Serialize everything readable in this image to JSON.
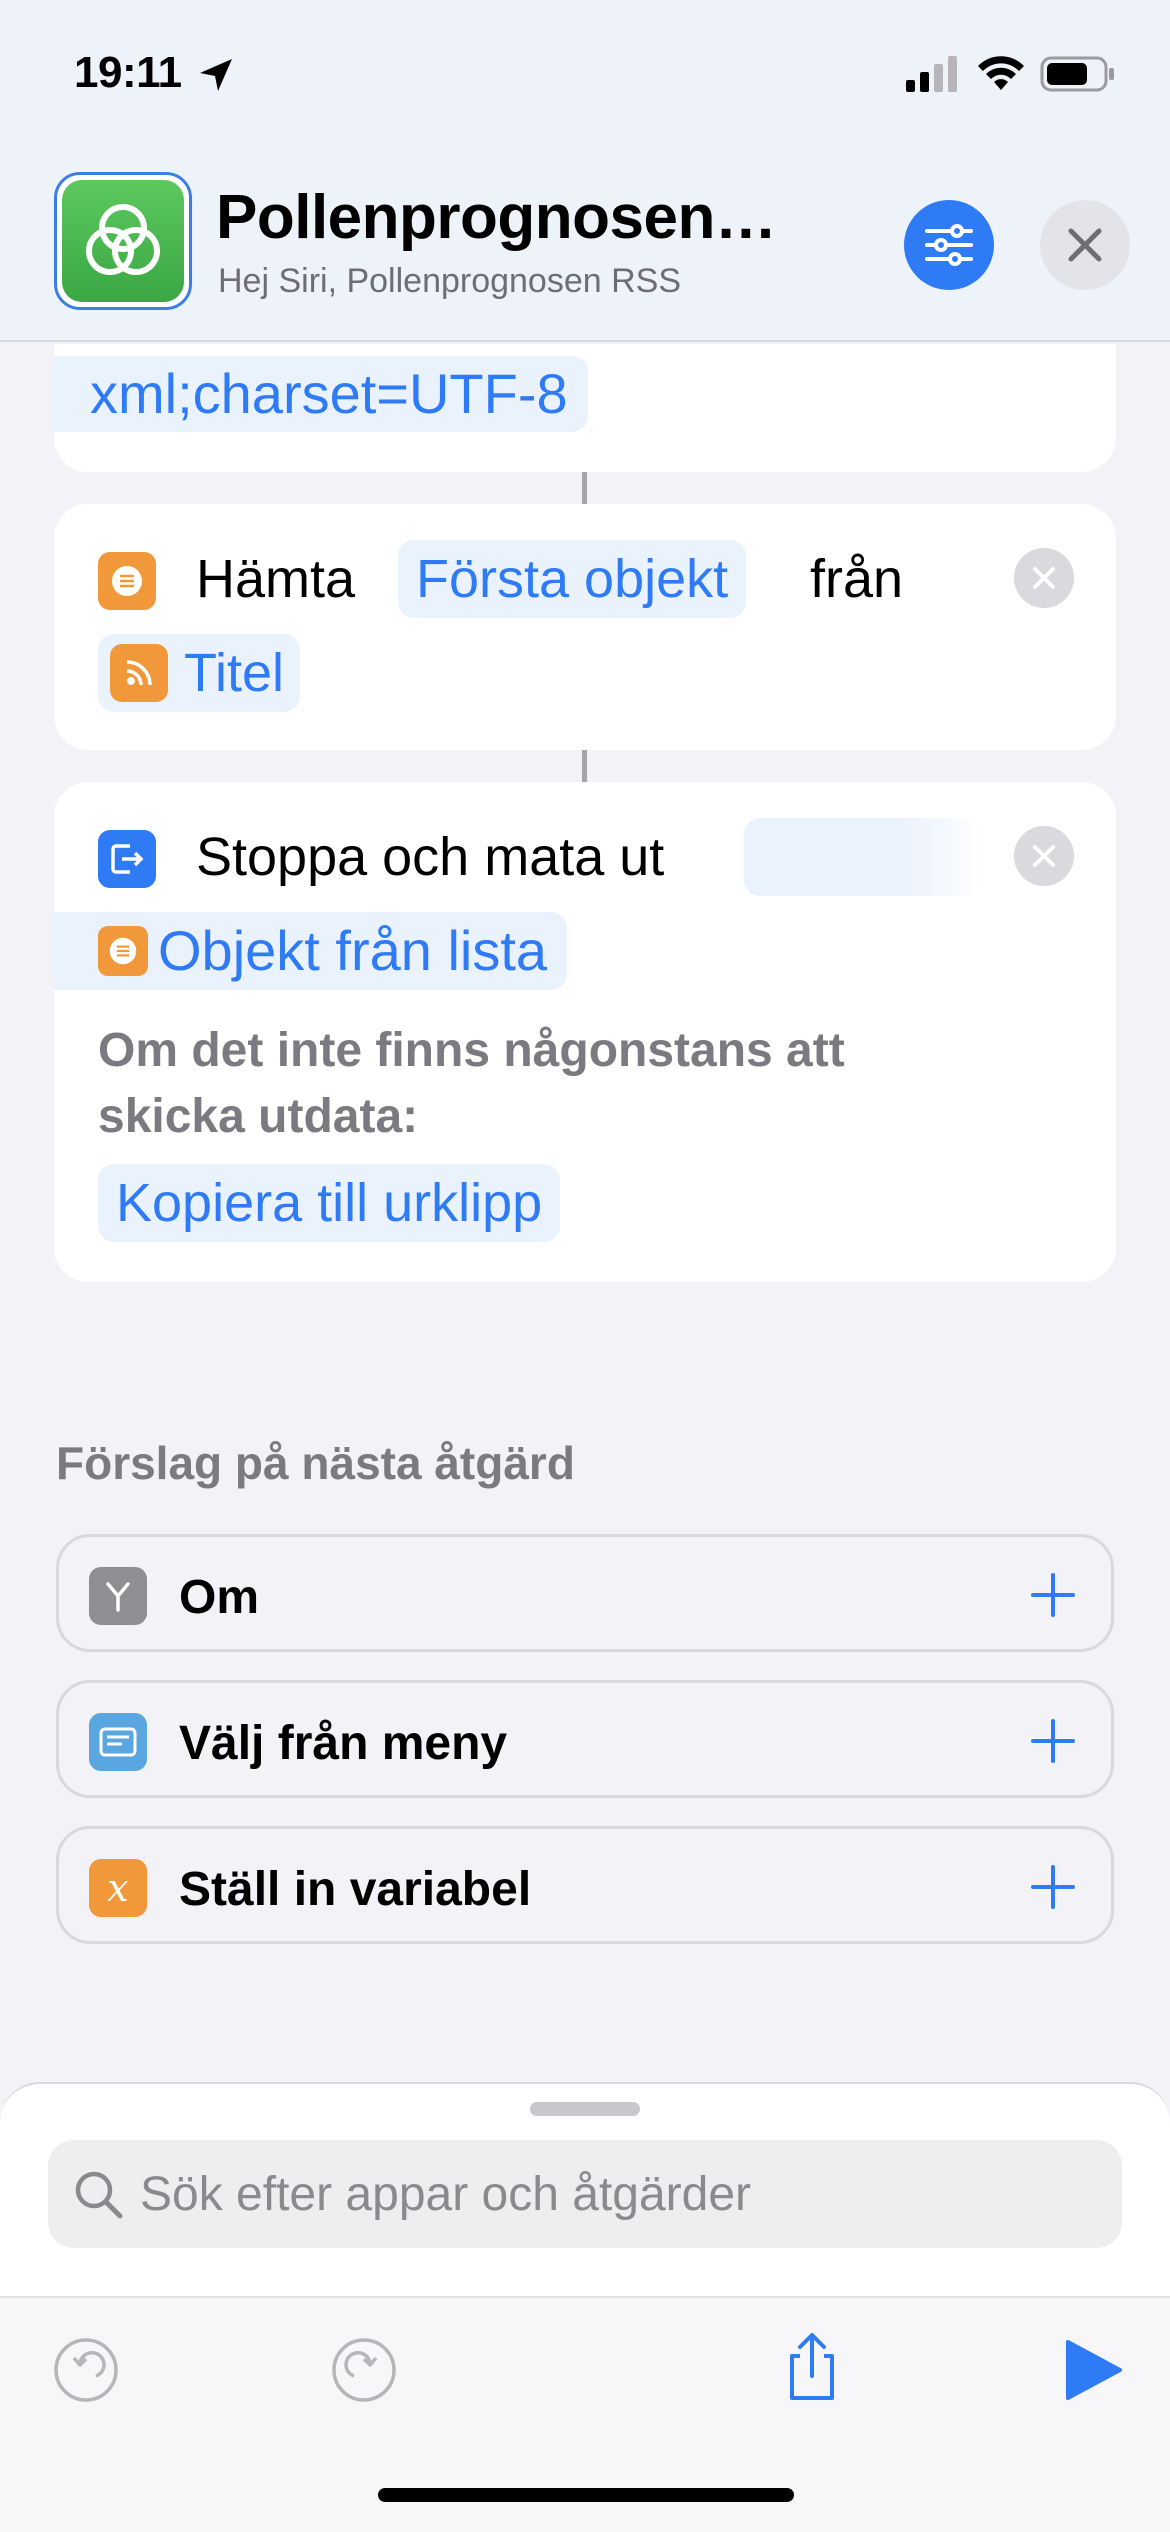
{
  "status_bar": {
    "time": "19:11",
    "icons": [
      "location-arrow-icon",
      "signal-icon",
      "wifi-icon",
      "battery-icon"
    ]
  },
  "header": {
    "title": "Pollenprognosen…",
    "subtitle": "Hej Siri, Pollenprognosen RSS",
    "app_icon": "pollen-circles-icon",
    "accent_color": "#2f7bf5"
  },
  "actions": {
    "card1": {
      "token": "xml;charset=UTF-8"
    },
    "card2": {
      "verb": "Hämta",
      "token1": "Första objekt",
      "preposition": "från",
      "token2": "Titel",
      "icon": "list-icon",
      "icon_color": "#f0983a"
    },
    "card3": {
      "verb": "Stoppa och mata ut",
      "token1": "Objekt från lista",
      "note": "Om det inte finns någonstans att skicka utdata:",
      "fallback": "Kopiera till urklipp",
      "icon": "output-icon",
      "icon_color": "#2f7bf5"
    }
  },
  "suggestions": {
    "header": "Förslag på nästa åtgärd",
    "items": [
      {
        "label": "Om",
        "icon": "branch-icon",
        "color": "#8e8e93"
      },
      {
        "label": "Välj från meny",
        "icon": "menu-icon",
        "color": "#5aa6e0"
      },
      {
        "label": "Ställ in variabel",
        "icon": "variable-icon",
        "color": "#f0983a"
      }
    ]
  },
  "search": {
    "placeholder": "Sök efter appar och åtgärder"
  },
  "toolbar": {
    "buttons": [
      "undo-icon",
      "redo-icon",
      "share-icon",
      "play-icon"
    ]
  }
}
